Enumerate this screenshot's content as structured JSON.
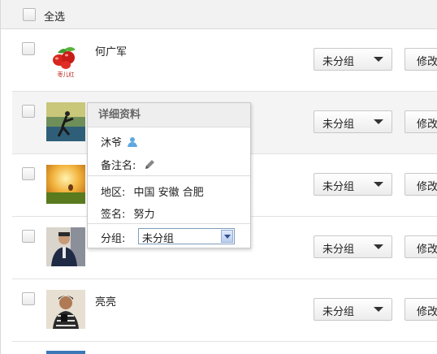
{
  "header": {
    "select_all_label": "全选"
  },
  "friends": [
    {
      "name": "何广军",
      "group": "未分组",
      "edit_label": "修改",
      "avatar_text": "枣儿红"
    },
    {
      "name": "",
      "group": "未分组",
      "edit_label": "修改"
    },
    {
      "name": "",
      "group": "未分组",
      "edit_label": "修改"
    },
    {
      "name": "",
      "group": "未分组",
      "edit_label": "修改"
    },
    {
      "name": "亮亮",
      "group": "未分组",
      "edit_label": "修改"
    }
  ],
  "popup": {
    "title": "详细资料",
    "nickname": "沐爷",
    "remark_label": "备注名:",
    "region_label": "地区:",
    "region_value": "中国 安徽 合肥",
    "signature_label": "签名:",
    "signature_value": "努力",
    "group_label": "分组:",
    "group_value": "未分组"
  },
  "icons": [
    "person-icon",
    "pencil-icon",
    "chevron-down-icon"
  ],
  "colors": {
    "header_bg": "#f2f2f2",
    "hover_row_bg": "#f4f4f4",
    "select_border": "#7f9db9"
  }
}
